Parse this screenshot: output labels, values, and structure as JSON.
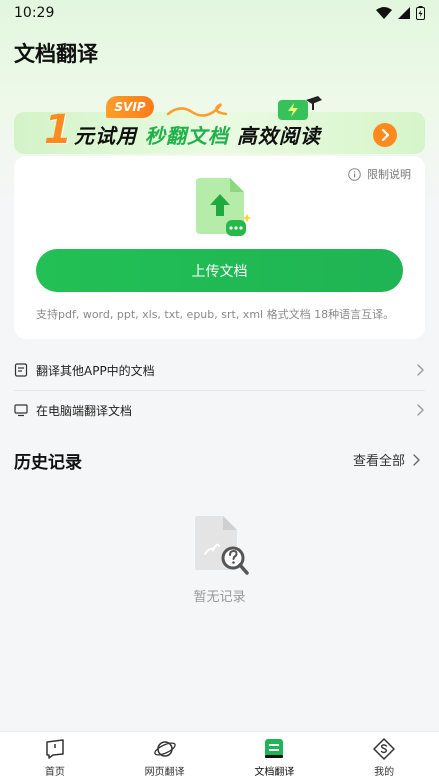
{
  "status_bar": {
    "time": "10:29"
  },
  "page_title": "文档翻译",
  "banner": {
    "badge": "SVIP",
    "number": "1",
    "text_part1": "元试用",
    "text_highlight": "秒翻文档",
    "text_part2": "高效阅读"
  },
  "upload_card": {
    "limit_label": "限制说明",
    "upload_button": "上传文档",
    "support_text": "支持pdf, word, ppt, xls, txt, epub, srt, xml 格式文档 18种语言互译。"
  },
  "rows": [
    {
      "label": "翻译其他APP中的文档",
      "icon": "document-icon"
    },
    {
      "label": "在电脑端翻译文档",
      "icon": "monitor-icon"
    }
  ],
  "history": {
    "title": "历史记录",
    "view_all": "查看全部",
    "empty_text": "暂无记录"
  },
  "bottom_nav": [
    {
      "label": "首页",
      "icon": "home-icon",
      "active": false
    },
    {
      "label": "网页翻译",
      "icon": "planet-icon",
      "active": false
    },
    {
      "label": "文档翻译",
      "icon": "doc-translate-icon",
      "active": true
    },
    {
      "label": "我的",
      "icon": "profile-icon",
      "active": false
    }
  ],
  "colors": {
    "primary_green": "#22c055",
    "accent_orange": "#ff8a1d"
  }
}
